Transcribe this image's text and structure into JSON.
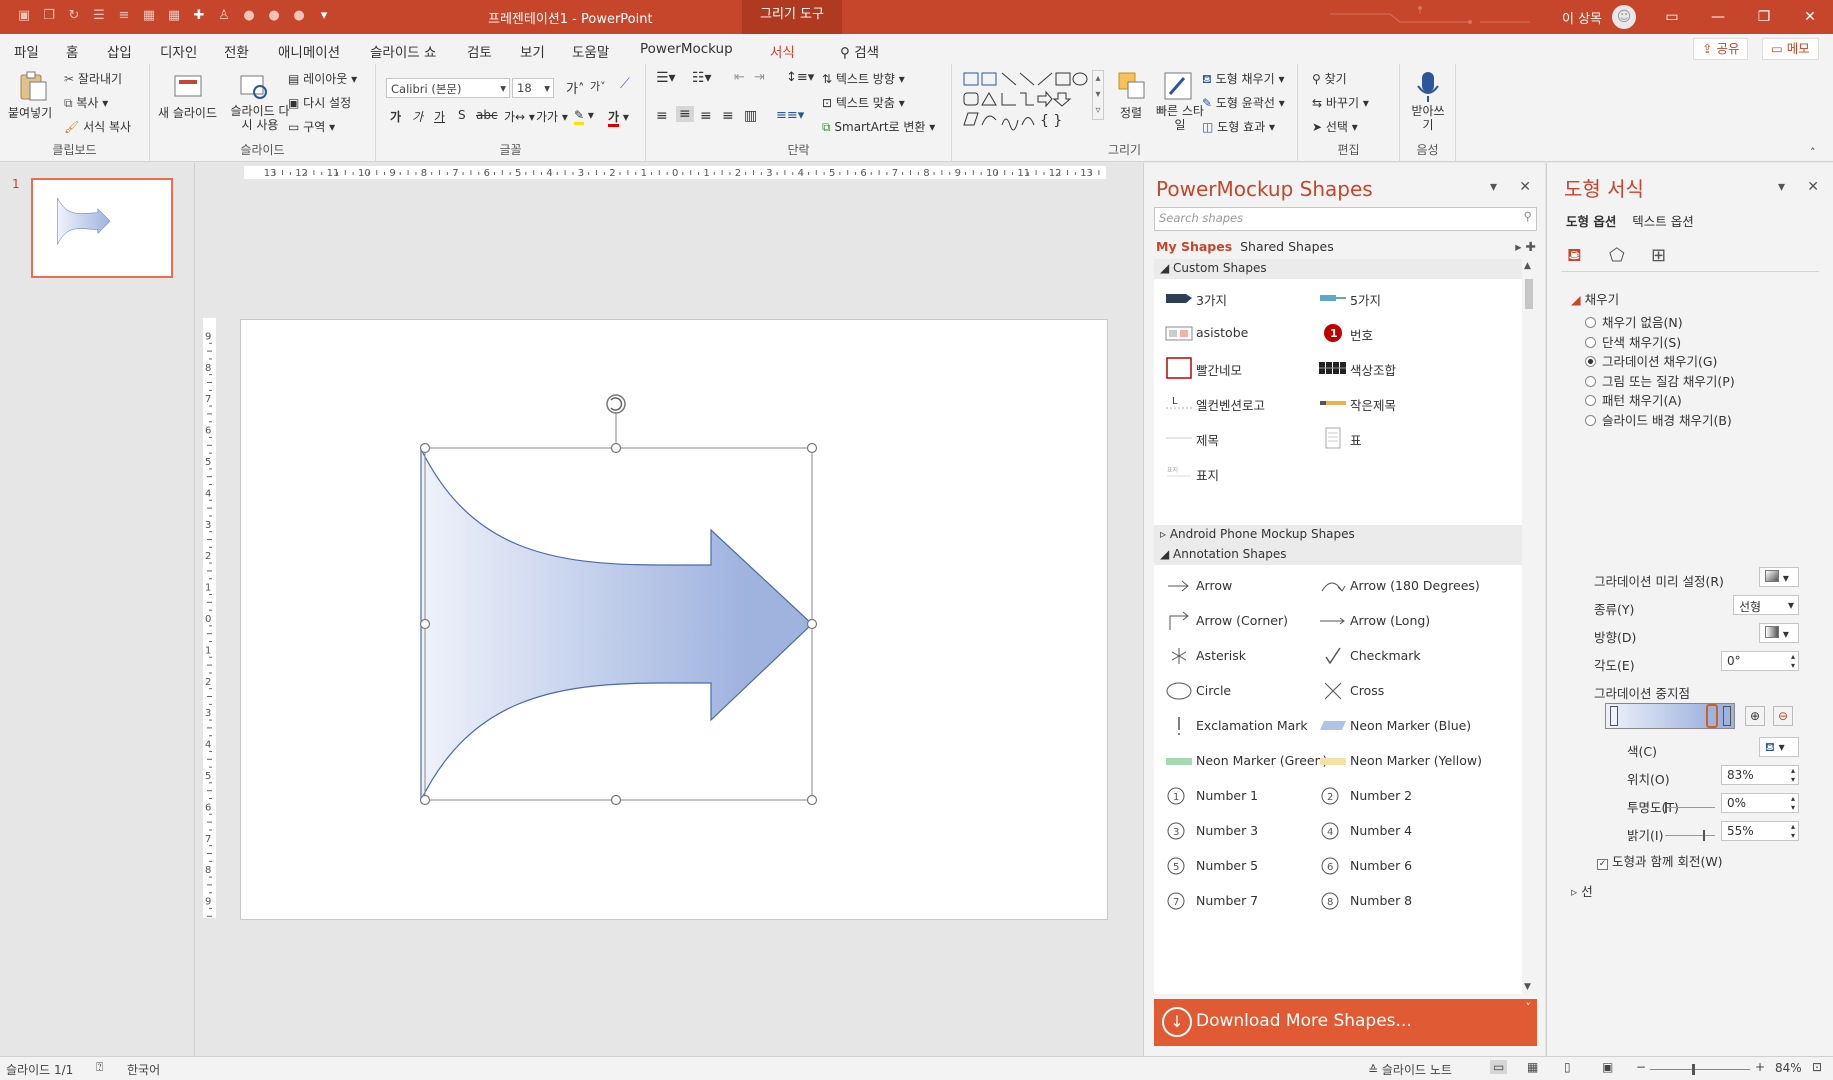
{
  "titlebar": {
    "title": "프레젠테이션1  -  PowerPoint",
    "context_tool": "그리기 도구",
    "user": "이 상목"
  },
  "tabs": [
    "파일",
    "홈",
    "삽입",
    "디자인",
    "전환",
    "애니메이션",
    "슬라이드 쇼",
    "검토",
    "보기",
    "도움말",
    "PowerMockup",
    "서식"
  ],
  "tell_me": "검색",
  "share_label": "공유",
  "memo_label": "메모",
  "ribbon": {
    "clipboard": {
      "paste": "붙여넣기",
      "cut": "잘라내기",
      "copy": "복사",
      "format_painter": "서식 복사",
      "label": "클립보드"
    },
    "slides": {
      "new_slide": "새 슬라이드",
      "reuse": "슬라이드 다시 사용",
      "layout": "레이아웃",
      "reset": "다시 설정",
      "section": "구역",
      "label": "슬라이드"
    },
    "font": {
      "font_name": "Calibri (본문)",
      "font_size": "18",
      "label": "글꼴"
    },
    "paragraph": {
      "text_direction": "텍스트 방향",
      "align_text": "텍스트 맞춤",
      "smartart": "SmartArt로 변환",
      "label": "단락"
    },
    "drawing": {
      "arrange": "정렬",
      "quick_styles": "빠른 스타일",
      "fill": "도형 채우기",
      "outline": "도형 윤곽선",
      "effects": "도형 효과",
      "label": "그리기"
    },
    "editing": {
      "find": "찾기",
      "replace": "바꾸기",
      "select": "선택",
      "label": "편집"
    },
    "voice": {
      "dictate": "받아쓰기",
      "label": "음성"
    }
  },
  "thumbnail": {
    "number": "1"
  },
  "powermockup": {
    "title": "PowerMockup Shapes",
    "search_placeholder": "Search shapes",
    "my_shapes": "My Shapes",
    "shared_shapes": "Shared Shapes",
    "sections": {
      "custom": "Custom Shapes",
      "android": "Android Phone Mockup Shapes",
      "annotation": "Annotation Shapes"
    },
    "custom_items": [
      "3가지",
      "5가지",
      "asistobe",
      "번호",
      "빨간네모",
      "색상조합",
      "엘컨벤션로고",
      "작은제목",
      "제목",
      "표",
      "표지"
    ],
    "annotation_items": [
      "Arrow",
      "Arrow (180 Degrees)",
      "Arrow (Corner)",
      "Arrow (Long)",
      "Asterisk",
      "Checkmark",
      "Circle",
      "Cross",
      "Exclamation Mark",
      "Neon Marker (Blue)",
      "Neon Marker (Green)",
      "Neon Marker (Yellow)",
      "Number 1",
      "Number 2",
      "Number 3",
      "Number 4",
      "Number 5",
      "Number 6",
      "Number 7",
      "Number 8"
    ],
    "download": "Download More Shapes..."
  },
  "format_pane": {
    "title": "도형 서식",
    "tab_shape": "도형 옵션",
    "tab_text": "텍스트 옵션",
    "fill_section": "채우기",
    "fill_options": [
      "채우기 없음(N)",
      "단색 채우기(S)",
      "그라데이션 채우기(G)",
      "그림 또는 질감 채우기(P)",
      "패턴 채우기(A)",
      "슬라이드 배경 채우기(B)"
    ],
    "selected_fill": "그라데이션 채우기(G)",
    "preset_label": "그라데이션 미리 설정(R)",
    "type_label": "종류(Y)",
    "type_value": "선형",
    "direction_label": "방향(D)",
    "angle_label": "각도(E)",
    "angle_value": "0°",
    "stops_label": "그라데이션 중지점",
    "color_label": "색(C)",
    "position_label": "위치(O)",
    "position_value": "83%",
    "transparency_label": "투명도(T)",
    "transparency_value": "0%",
    "brightness_label": "밝기(I)",
    "brightness_value": "55%",
    "rotate_label": "도형과 함께 회전(W)",
    "line_section": "선"
  },
  "statusbar": {
    "slide_info": "슬라이드 1/1",
    "language": "한국어",
    "notes": "슬라이드 노트",
    "zoom": "84%"
  },
  "colors": {
    "accent": "#c5462a",
    "arrow_light": "#eef2fa",
    "arrow_dark": "#9fb3df"
  }
}
